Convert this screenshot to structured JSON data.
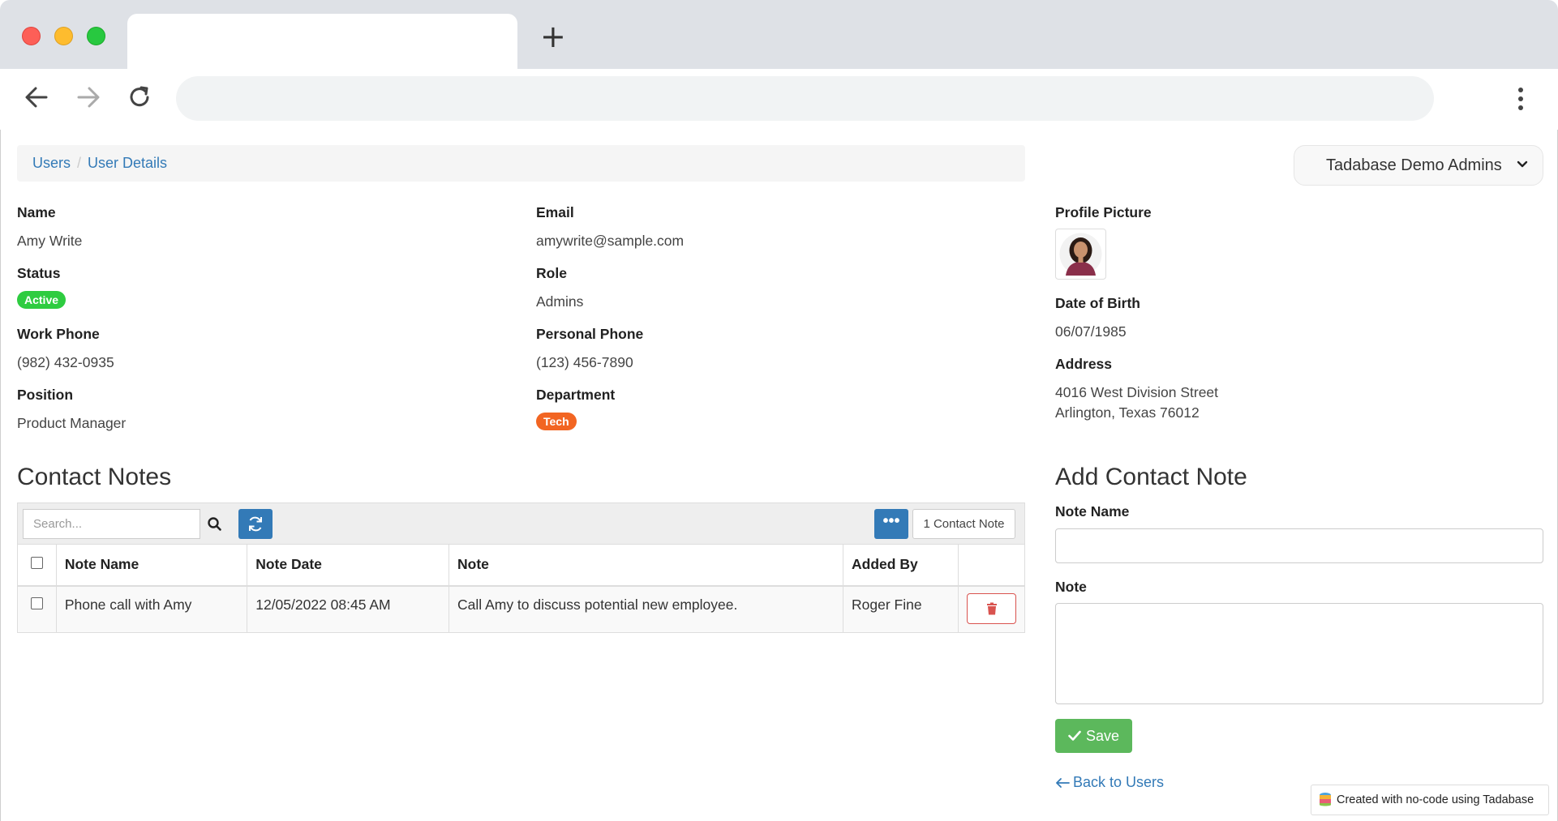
{
  "browser": {
    "new_tab_icon": "plus-icon",
    "back_icon": "arrow-left-icon",
    "forward_icon": "arrow-right-icon",
    "reload_icon": "reload-icon",
    "menu_icon": "kebab-menu-icon",
    "traffic_lights": [
      "#fd5f57",
      "#febc2e",
      "#28c840"
    ]
  },
  "breadcrumb": {
    "items": [
      "Users",
      "User Details"
    ],
    "separator": "/"
  },
  "account_menu": {
    "label": "Tadabase Demo Admins",
    "icon": "chevron-down-icon"
  },
  "details": {
    "name": {
      "label": "Name",
      "value": "Amy Write"
    },
    "email": {
      "label": "Email",
      "value": "amywrite@sample.com"
    },
    "status": {
      "label": "Status",
      "value": "Active",
      "color": "#2ecc40"
    },
    "role": {
      "label": "Role",
      "value": "Admins"
    },
    "work_phone": {
      "label": "Work Phone",
      "value": "(982) 432-0935"
    },
    "personal_phone": {
      "label": "Personal Phone",
      "value": "(123) 456-7890"
    },
    "position": {
      "label": "Position",
      "value": "Product Manager"
    },
    "department": {
      "label": "Department",
      "value": "Tech",
      "color": "#f26522"
    },
    "profile_picture": {
      "label": "Profile Picture"
    },
    "dob": {
      "label": "Date of Birth",
      "value": "06/07/1985"
    },
    "address": {
      "label": "Address",
      "line1": "4016 West Division Street",
      "line2": "Arlington, Texas 76012"
    }
  },
  "contact_notes": {
    "title": "Contact Notes",
    "search_placeholder": "Search...",
    "count_label": "1 Contact Note",
    "more_label": "•••",
    "columns": [
      "Note Name",
      "Note Date",
      "Note",
      "Added By"
    ],
    "rows": [
      {
        "note_name": "Phone call with Amy",
        "note_date": "12/05/2022 08:45 AM",
        "note": "Call Amy to discuss potential new employee.",
        "added_by": "Roger Fine"
      }
    ]
  },
  "add_note": {
    "title": "Add Contact Note",
    "note_name_label": "Note Name",
    "note_label": "Note",
    "note_name_value": "",
    "note_value": "",
    "save_label": "Save",
    "back_label": "Back to Users"
  },
  "footer": {
    "label": "Created with no-code using Tadabase"
  },
  "colors": {
    "link": "#337ab7",
    "primary": "#337ab7",
    "success": "#5cb85c",
    "danger": "#d9534f"
  }
}
